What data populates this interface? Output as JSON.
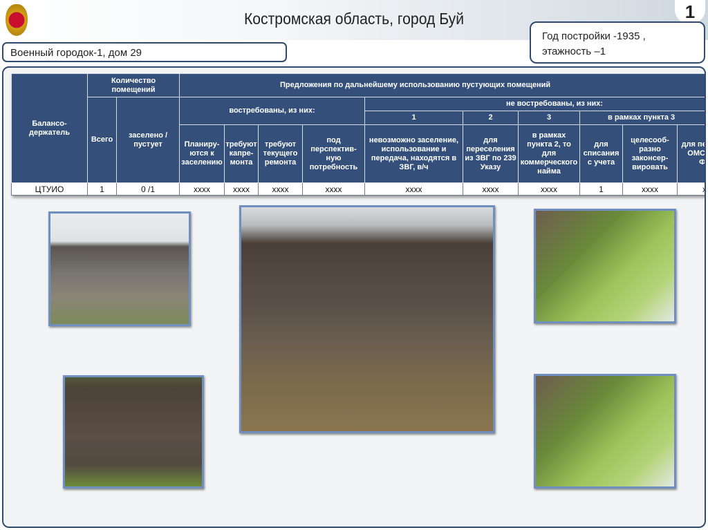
{
  "header": {
    "title": "Костромская область, город Буй",
    "slide_number": "1",
    "info_line1": "Год постройки  -1935 ,",
    "info_line2": "этажность –1",
    "subtitle": "Военный городок-1, дом  29"
  },
  "table": {
    "h_holder": "Балансо-держатель",
    "h_count": "Количество помещений",
    "h_proposals": "Предложения по дальнейшему использованию пустующих помещений",
    "h_total": "Всего",
    "h_occupied": "заселено / пустует",
    "h_demanded": "востребованы, из них:",
    "h_not_demanded": "не востребованы, из них:",
    "h_n1": "1",
    "h_n2": "2",
    "h_n3": "3",
    "h_within3": "в рамках пункта 3",
    "cols": [
      "Планиру-ются к заселению",
      "требуют капре-монта",
      "требуют текущего ремонта",
      "под перспектив-ную потребность",
      "невозможно заселение, использование и передача, находятся в ЗВГ, в/ч",
      "для переселения из ЗВГ по 239 Указу",
      "в рамках пункта 2, то для коммерческого найма",
      "для списания с учета",
      "целесооб-разно законсер-вировать",
      "для передачи в ОМС и иные ФОИВ"
    ],
    "row": [
      "ЦТУИО",
      "1",
      "0 /1",
      "xxxx",
      "xxxx",
      "xxxx",
      "xxxx",
      "xxxx",
      "xxxx",
      "xxxx",
      "1",
      "xxxx",
      "xxxx"
    ]
  },
  "photos": [
    "house-photo-1",
    "house-photo-2",
    "house-photo-3",
    "house-photo-4",
    "house-photo-5"
  ]
}
